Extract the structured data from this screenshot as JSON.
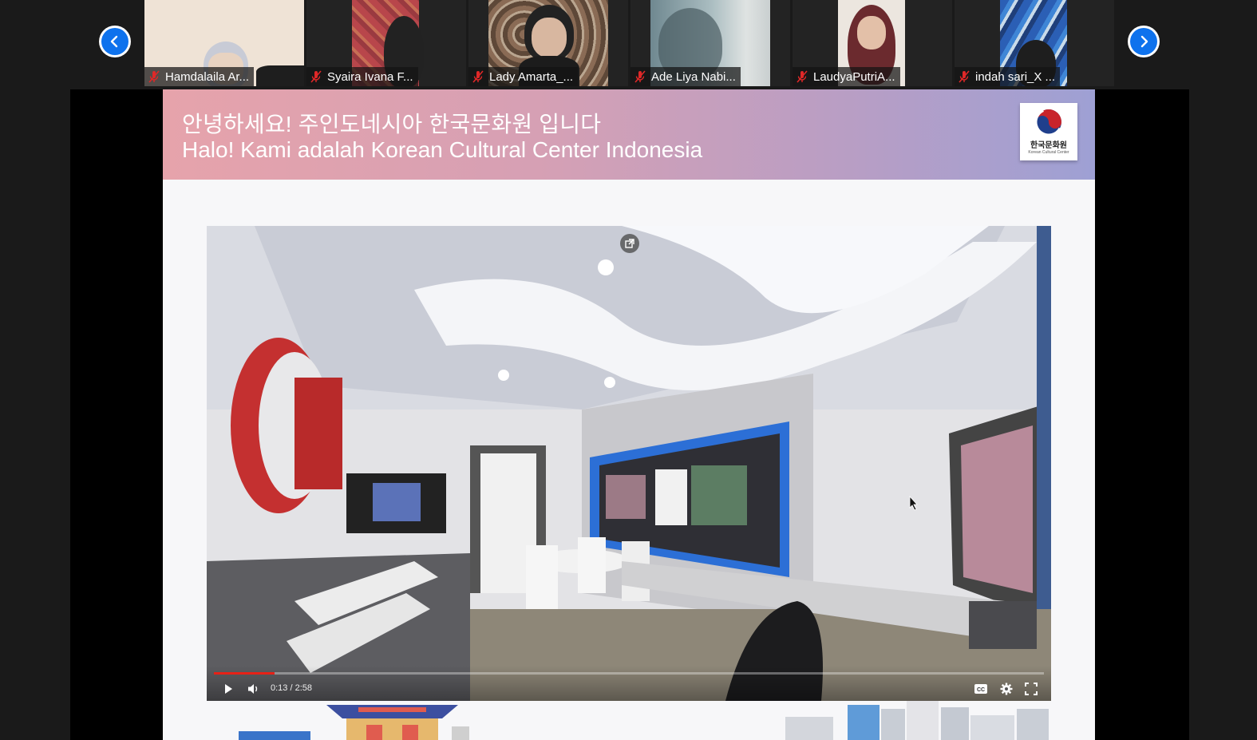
{
  "gallery": {
    "participants": [
      {
        "name": "Hamdalaila Ar..."
      },
      {
        "name": "Syaira Ivana F..."
      },
      {
        "name": "Lady Amarta_..."
      },
      {
        "name": "Ade Liya Nabi..."
      },
      {
        "name": "LaudyaPutriA..."
      },
      {
        "name": "indah sari_X ..."
      }
    ]
  },
  "slide": {
    "header_korean": "안녕하세요! 주인도네시아 한국문화원 입니다",
    "header_indonesian": "Halo! Kami adalah Korean Cultural Center Indonesia",
    "logo_text": "한국문화원",
    "logo_subtext": "Korean Cultural Center"
  },
  "player": {
    "time": "0:13 / 2:58",
    "progress": 0.073
  },
  "colors": {
    "accent": "#0e72ed",
    "progress": "#e62117",
    "mute": "#e02828"
  }
}
